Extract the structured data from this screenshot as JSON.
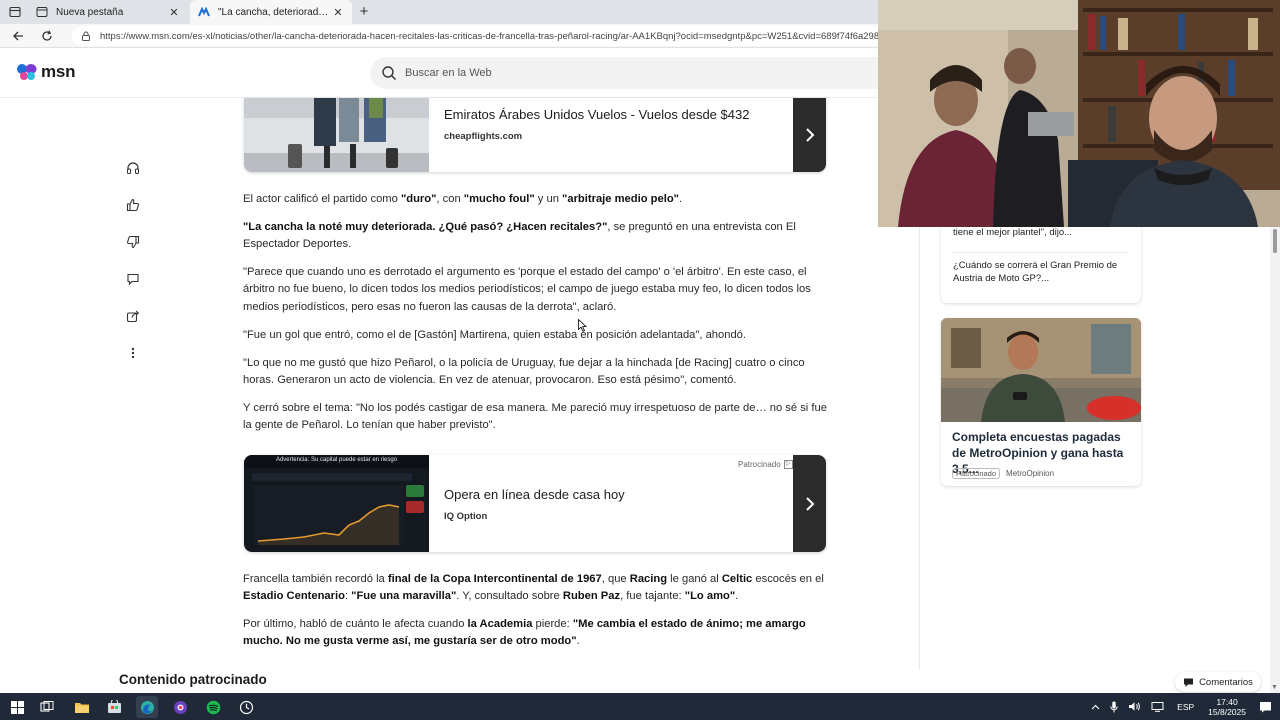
{
  "browser": {
    "tabs": [
      {
        "title": "Nueva pestaña",
        "active": false
      },
      {
        "title": "\"La cancha, deteriorada. ¿Hacen recitales?\"",
        "active": true
      }
    ],
    "new_tab_label": "+",
    "close_glyph": "✕",
    "url": "https://www.msn.com/es-xl/noticias/other/la-cancha-deteriorada-hacen-recitales-las-criticas-de-francella-tras-peñarol-racing/ar-AA1KBqnj?ocid=msedgntp&pc=W251&cvid=689f74f6a2984"
  },
  "msn": {
    "logo_text": "msn",
    "search_placeholder": "Buscar en la Web"
  },
  "rail": {
    "icons": [
      "headphones-icon",
      "thumbs-up-icon",
      "thumbs-down-icon",
      "comment-icon",
      "share-icon",
      "more-icon"
    ]
  },
  "article": {
    "ad_top": {
      "title": "Emiratos Árabes Unidos Vuelos - Vuelos desde $432",
      "source": "cheapflights.com"
    },
    "p1": {
      "t1": "El actor calificó el partido como ",
      "b1": "\"duro\"",
      "t2": ", con ",
      "b2": "\"mucho foul\"",
      "t3": " y un ",
      "b3": "\"arbitraje medio pelo\"",
      "t4": "."
    },
    "p2": {
      "b1": "\"La cancha la noté muy deteriorada. ¿Qué pasó? ¿Hacen recitales?\"",
      "t1": ", se preguntó en una entrevista con El Espectador Deportes."
    },
    "p3": "\"Parece que cuando uno es derrotado el argumento es 'porque el estado del campo' o 'el árbitro'. En este caso, el árbitro no fue bueno, lo dicen todos los medios periodísticos; el campo de juego estaba muy feo, lo dicen todos los medios periodísticos, pero esas no fueron las causas de la derrota\", aclaró.",
    "p4": "\"Fue un gol que entró, como el de [Gastón] Martirena, quien estaba en posición adelantada\", ahondó.",
    "p5": "\"Lo que no me gustó que hizo Peñarol, o la policía de Uruguay, fue dejar a la hinchada [de Racing] cuatro o cinco horas. Generaron un acto de violencia. En vez de atenuar, provocaron. Eso está pésimo\", comentó.",
    "p6": "Y cerró sobre el tema: \"No los podés castigar de esa manera. Me pareció muy irrespetuoso de parte de… no sé si fue la gente de Peñarol. Lo tenían que haber previsto\".",
    "ad_mid": {
      "sponsor_label": "Patrocinado",
      "banner_text": "Advertencia: Su capital puede estar en riesgo",
      "title": "Opera en línea desde casa hoy",
      "source": "IQ Option"
    },
    "p7": {
      "t1": "Francella también recordó la ",
      "b1": "final de la Copa Intercontinental de 1967",
      "t2": ", que ",
      "b2": "Racing",
      "t3": " le ganó al ",
      "b3": "Celtic",
      "t4": " escocés en el ",
      "b4": "Estadio Centenario",
      "t5": ": ",
      "b5": "\"Fue una maravilla\"",
      "t6": ". Y, consultado sobre ",
      "b6": "Ruben Paz",
      "t7": ", fue tajante: ",
      "b7": "\"Lo amo\"",
      "t8": "."
    },
    "p8": {
      "t1": "Por último, habló de cuánto le afecta cuando ",
      "b1": "la Academia",
      "t2": " pierde: ",
      "b2": "\"Me cambia el estado de ánimo; me amargo mucho. No me gusta verme así, me gustaría ser de otro modo\"",
      "t3": "."
    },
    "sponsored_heading": "Contenido patrocinado"
  },
  "right_rail": {
    "items": [
      "tiene el mejor plantel\", dijo...",
      "¿Cuándo se correrá el Gran Premio de Austria de Moto GP?..."
    ],
    "ad": {
      "title": "Completa encuestas pagadas de MetroOpinion y gana hasta 3,5...",
      "badge": "Patrocinado",
      "advertiser": "MetroOpinion"
    },
    "comments_label": "Comentarios"
  },
  "taskbar": {
    "apps": [
      "windows-start-icon",
      "task-view-icon",
      "file-explorer-icon",
      "store-icon",
      "edge-icon",
      "browser-icon",
      "spotify-icon",
      "clock-app-icon"
    ],
    "language": "ESP",
    "time": "17:40",
    "date": "15/8/2025"
  },
  "colors": {
    "accent_dark": "#2b2b2b",
    "msn_blue": "#1d6fd8",
    "taskbar": "#1f2937",
    "spotify": "#1db954"
  }
}
